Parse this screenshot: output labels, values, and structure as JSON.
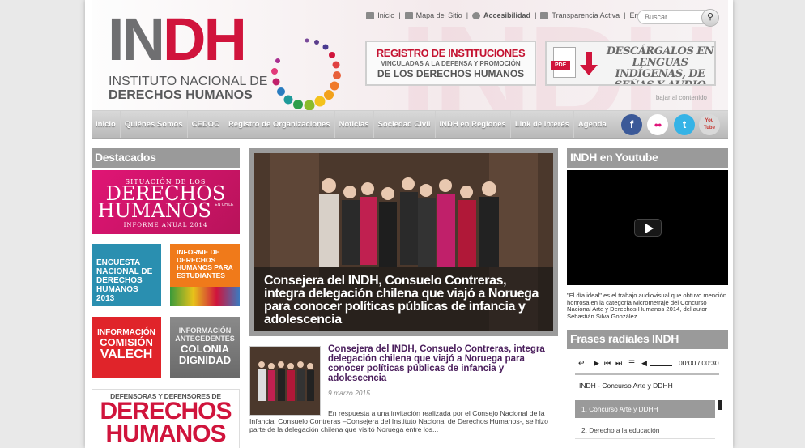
{
  "logo": {
    "big_gray": "IN",
    "big_red": "DH",
    "line1": "INSTITUTO NACIONAL DE",
    "line2": "DERECHOS HUMANOS",
    "watermark": "INDH"
  },
  "toplinks": [
    {
      "label": "Inicio",
      "icon": "home-icon"
    },
    {
      "label": "Mapa del Sitio",
      "icon": "sitemap-icon"
    },
    {
      "label": "Accesibilidad",
      "icon": "accessibility-icon"
    },
    {
      "label": "Transparencia Activa",
      "icon": "transparency-icon"
    },
    {
      "label": "English"
    }
  ],
  "search": {
    "placeholder": "Buscar..."
  },
  "banner_registro": {
    "line1": "REGISTRO DE INSTITUCIONES",
    "line2": "VINCULADAS A LA DEFENSA Y PROMOCIÓN",
    "line3": "DE LOS DERECHOS HUMANOS"
  },
  "banner_descarga": {
    "pdf": "PDF",
    "text": "DESCÁRGALOS EN LENGUAS INDÍGENAS, DE SEÑAS Y AUDIO"
  },
  "skip_link": "bajar al contenido",
  "nav": [
    "Inicio",
    "Quiénes Somos",
    "CEDOC",
    "Registro de Organizaciones",
    "Noticias",
    "Sociedad Civil",
    "INDH en Regiones",
    "Link de Interés",
    "Agenda"
  ],
  "social": [
    {
      "icon": "facebook-icon",
      "glyph": "f",
      "color": "#3b5998"
    },
    {
      "icon": "flickr-icon",
      "glyph": "●●",
      "color": "#ffffff"
    },
    {
      "icon": "twitter-icon",
      "glyph": "t",
      "color": "#35b3e6"
    },
    {
      "icon": "youtube-icon",
      "glyph": "You Tube",
      "color": "#d9d9d9"
    }
  ],
  "destacados": {
    "heading": "Destacados",
    "informe": {
      "l1": "SITUACIÓN DE LOS",
      "l2": "DERECHOS",
      "l3": "HUMANOS",
      "l4": "EN CHILE",
      "l5": "INFORME ANUAL 2014"
    },
    "encuesta": "ENCUESTA NACIONAL DE DERECHOS HUMANOS 2013",
    "informe_estudiantes": "INFORME DE DERECHOS HUMANOS PARA ESTUDIANTES",
    "valech": {
      "l1": "INFORMACIÓN",
      "l2": "COMISIÓN",
      "l3": "VALECH"
    },
    "colonia": {
      "l1": "INFORMACIÓN",
      "l2": "ANTECEDENTES",
      "l3": "COLONIA",
      "l4": "DIGNIDAD"
    },
    "defensoras": {
      "l1": "DEFENSORAS Y DEFENSORES DE",
      "l2": "DERECHOS",
      "l3": "HUMANOS"
    }
  },
  "main": {
    "caption": "Consejera del INDH, Consuelo Contreras, integra delegación chilena que viajó a Noruega para conocer políticas públicas de infancia y adolescencia",
    "article_title": "Consejera del INDH, Consuelo Contreras, integra delegación chilena que viajó a Noruega para conocer políticas públicas de infancia y adolescencia",
    "article_date": "9 marzo 2015",
    "article_body": "En respuesta a una invitación realizada por el Consejo Nacional de la Infancia, Consuelo Contreras –Consejera del Instituto Nacional de Derechos Humanos-, se hizo parte de la delegación chilena que visitó Noruega entre los..."
  },
  "youtube": {
    "heading": "INDH en Youtube",
    "caption": "\"El día ideal\" es el trabajo audiovisual que obtuvo mención honrosa en la categoría Micrometraje del Concurso Nacional Arte y Derechos Humanos 2014, del autor Sebastián Silva González."
  },
  "radio": {
    "heading": "Frases radiales INDH",
    "time": "00:00 / 00:30",
    "now": "INDH - Concurso Arte y DDHH",
    "tracks": [
      "1. Concurso Arte y DDHH",
      "2. Derecho a la educación"
    ]
  },
  "colors": {
    "brand_red": "#d0143c",
    "brand_gray": "#6f6f71",
    "nav_gray": "#b9b9b9",
    "heading_gray": "#9a9a9a",
    "title_purple": "#4a1e5c"
  }
}
